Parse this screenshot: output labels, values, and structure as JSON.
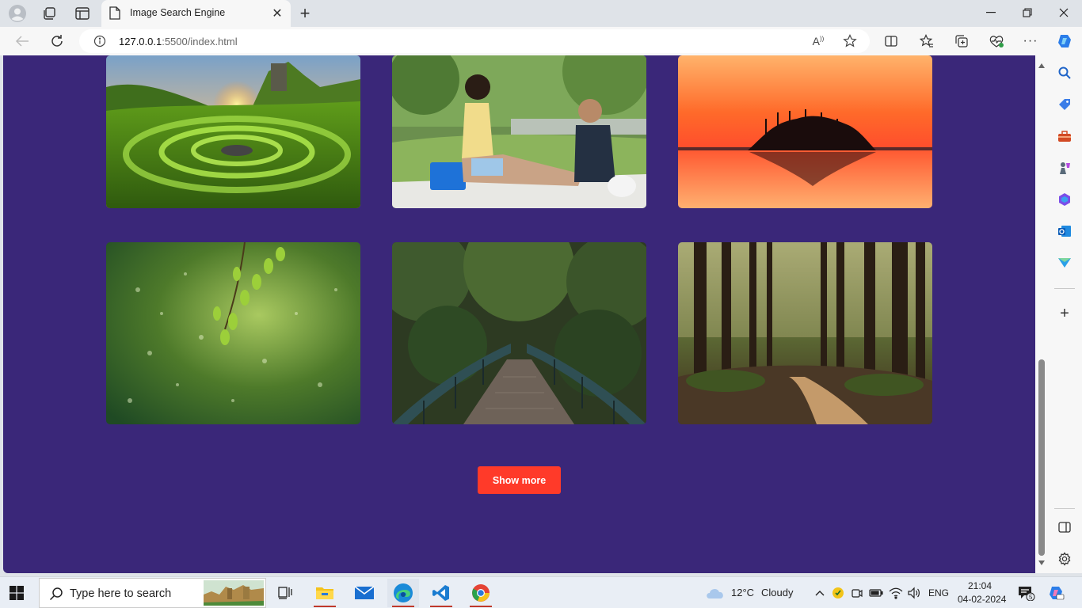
{
  "browser": {
    "tab_title": "Image Search Engine",
    "url_host": "127.0.0.1",
    "url_rest": ":5500/index.html"
  },
  "page": {
    "background_color": "#3a2779",
    "show_more_label": "Show more",
    "show_more_color": "#ff3a29",
    "images": [
      {
        "name": "image-green-hills-sunset",
        "icon": "landscape-image"
      },
      {
        "name": "image-couple-picnic",
        "icon": "people-image"
      },
      {
        "name": "image-lake-sunset-island",
        "icon": "sunset-image"
      },
      {
        "name": "image-green-leaves-bokeh",
        "icon": "leaves-image"
      },
      {
        "name": "image-forest-bridge",
        "icon": "bridge-image"
      },
      {
        "name": "image-forest-path",
        "icon": "forest-image"
      }
    ]
  },
  "taskbar": {
    "search_placeholder": "Type here to search",
    "weather_temp": "12°C",
    "weather_desc": "Cloudy",
    "language": "ENG",
    "time": "21:04",
    "date": "04-02-2024",
    "notification_count": "5"
  }
}
